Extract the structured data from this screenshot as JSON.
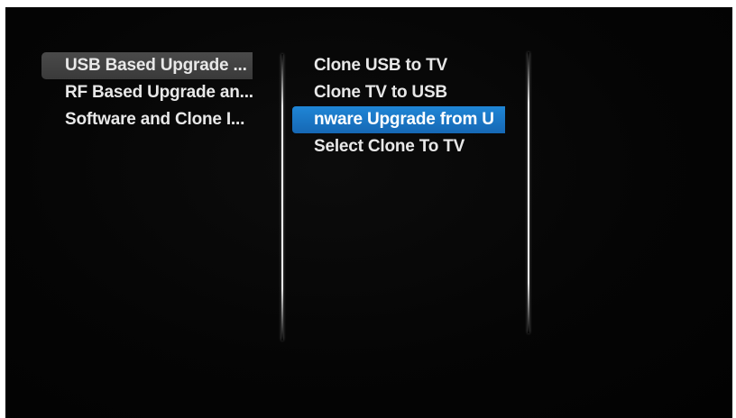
{
  "menu": {
    "left_column": {
      "items": [
        {
          "label": "USB Based Upgrade ...",
          "state": "parent-selected"
        },
        {
          "label": "RF Based Upgrade an...",
          "state": "normal"
        },
        {
          "label": "Software and Clone I...",
          "state": "normal"
        }
      ]
    },
    "middle_column": {
      "items": [
        {
          "label": "Clone USB to TV",
          "state": "normal"
        },
        {
          "label": "Clone TV to USB",
          "state": "normal"
        },
        {
          "label": "nware Upgrade from U",
          "state": "focused"
        },
        {
          "label": "Select Clone To TV",
          "state": "normal"
        }
      ]
    }
  },
  "colors": {
    "background": "#050505",
    "text": "#e8e8e8",
    "focus_highlight": "#1a78c8",
    "parent_highlight": "#424242",
    "divider": "#ffffff"
  }
}
